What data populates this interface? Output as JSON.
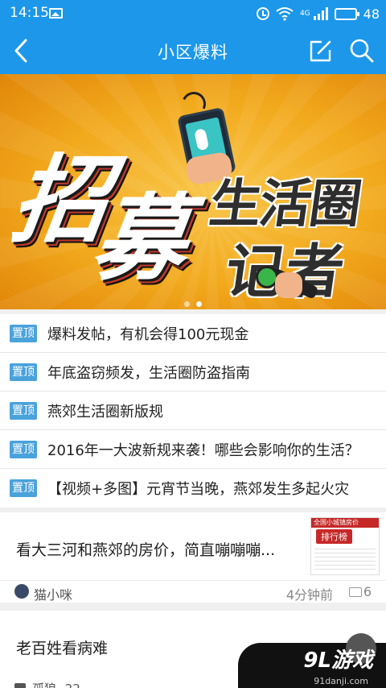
{
  "status_bar": {
    "time": "14:15",
    "network": "4G",
    "battery_level": "48",
    "battery_fraction": 0.48
  },
  "header": {
    "title": "小区爆料"
  },
  "banner": {
    "line1": "招",
    "line2": "募",
    "line3": "生活圈",
    "line4": "记者",
    "carousel_count": 2,
    "carousel_active": 2
  },
  "pinned": {
    "tag": "置顶",
    "items": [
      "爆料发帖，有机会得100元现金",
      "年底盗窃频发，生活圈防盗指南",
      "燕郊生活圈新版规",
      "2016年一大波新规来袭！哪些会影响你的生活？",
      "【视频+多图】元宵节当晚，燕郊发生多起火灾"
    ]
  },
  "posts": [
    {
      "title": "看大三河和燕郊的房价，简直嘣嘣嘣...",
      "thumb_header": "全国小城镇房价",
      "thumb_title": "排行榜",
      "author": "猫小咪",
      "time": "4分钟前",
      "comments": "6"
    },
    {
      "title": "老百姓看病难",
      "author": "孤狼",
      "time": "22"
    }
  ],
  "watermark": {
    "brand": "9L游戏",
    "url": "91danji.com"
  }
}
